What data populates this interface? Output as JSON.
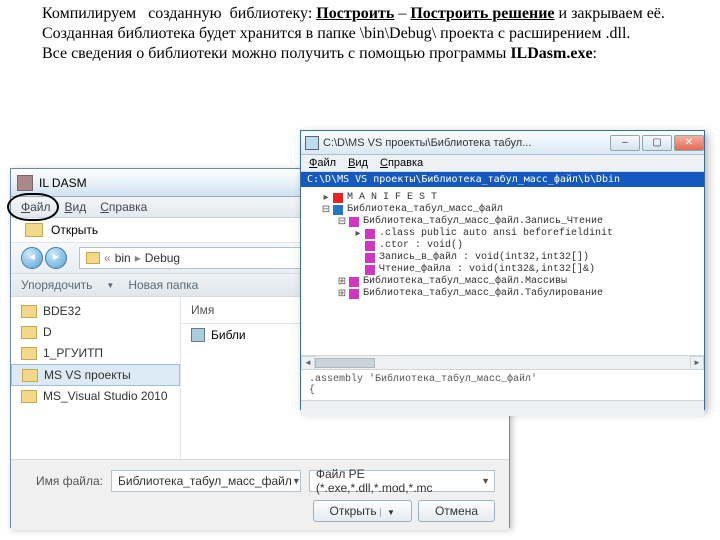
{
  "doc": {
    "p1a": "Компилируем   созданную  библиотеку: ",
    "p1b": "Построить",
    "p1c": " – ",
    "p1d": "Построить решение",
    "p1e": " и закрываем её.",
    "p2": "Созданная библиотека будет хранится в папке \\bin\\Debug\\ проекта с расширением .dll.",
    "p3a": "Все сведения о библиотеки можно получить с помощью программы ",
    "p3b": "ILDasm.exe",
    "p3c": ":"
  },
  "open_dialog": {
    "title": "IL DASM",
    "menu": {
      "file": "Файл",
      "view": "Вид",
      "help": "Справка"
    },
    "open_label": "Открыть",
    "breadcrumbs": {
      "a": "bin",
      "b": "Debug"
    },
    "toolbar": {
      "organize": "Упорядочить",
      "newfolder": "Новая папка"
    },
    "side_items": [
      "BDE32",
      "D",
      "1_РГУИТП",
      "MS VS проекты",
      "MS_Visual Studio 2010"
    ],
    "col_name": "Имя",
    "result_label": "Библи",
    "file_label": "Имя файла:",
    "file_value": "Библиотека_табул_масс_файл",
    "filter_value": "Файл PE (*.exe,*.dll,*.mod,*.mc",
    "btn_open": "Открыть",
    "btn_cancel": "Отмена"
  },
  "ild": {
    "title": "C:\\D\\MS VS проекты\\Библиотека табул...",
    "menu": {
      "file": "Файл",
      "view": "Вид",
      "help": "Справка"
    },
    "path": "C:\\D\\MS VS проекты\\Библиотека_табул_масс_файл\\b\\Dbin",
    "nodes": {
      "manifest": "M A N I F E S T",
      "root": "Библиотека_табул_масс_файл",
      "n1": "Библиотека_табул_масс_файл.Запись_Чтение",
      "n1a": ".class public auto ansi beforefieldinit",
      "n1b": ".ctor : void()",
      "n1c": "Запись_в_файл : void(int32,int32[])",
      "n1d": "Чтение_файла : void(int32&,int32[]&)",
      "n2": "Библиотека_табул_масс_файл.Массивы",
      "n3": "Библиотека_табул_масс_файл.Табулирование"
    },
    "info1": ".assembly 'Библиотека_табул_масс_файл'",
    "info2": "{"
  }
}
